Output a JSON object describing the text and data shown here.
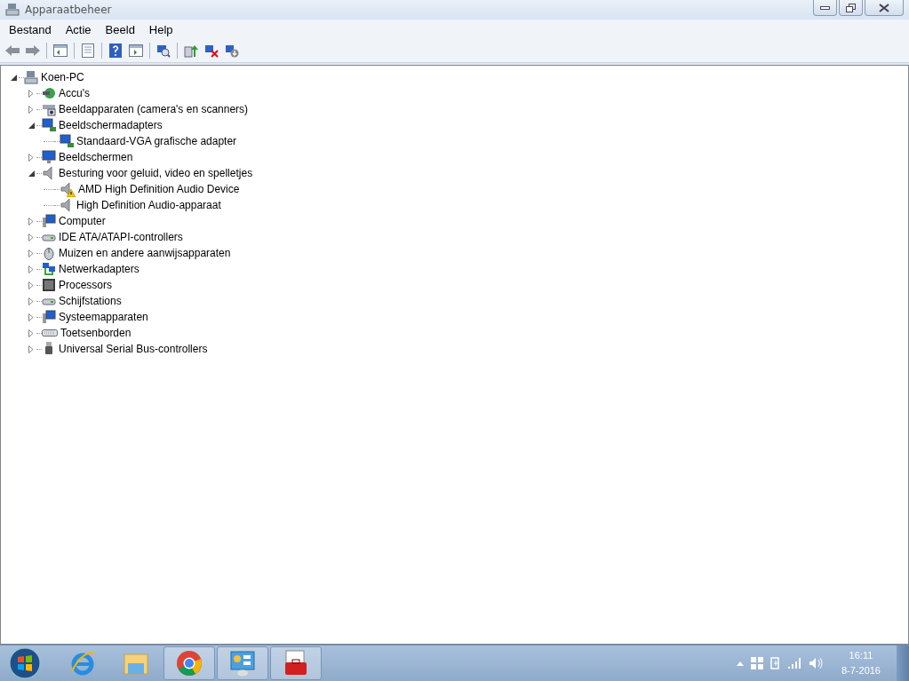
{
  "window": {
    "title": "Apparaatbeheer"
  },
  "menu": [
    "Bestand",
    "Actie",
    "Beeld",
    "Help"
  ],
  "toolbar": [
    {
      "kind": "back",
      "disabled": false
    },
    {
      "kind": "forward",
      "disabled": false
    },
    {
      "kind": "sep"
    },
    {
      "kind": "console"
    },
    {
      "kind": "sep"
    },
    {
      "kind": "properties"
    },
    {
      "kind": "sep"
    },
    {
      "kind": "help"
    },
    {
      "kind": "action"
    },
    {
      "kind": "sep"
    },
    {
      "kind": "scan"
    },
    {
      "kind": "sep"
    },
    {
      "kind": "update"
    },
    {
      "kind": "uninstall"
    },
    {
      "kind": "disable"
    }
  ],
  "tree": {
    "label": "Koen-PC",
    "kind": "pc",
    "expanded": true,
    "children": [
      {
        "label": "Accu's",
        "kind": "battery",
        "expanded": false
      },
      {
        "label": "Beeldapparaten (camera's en scanners)",
        "kind": "scanner",
        "expanded": false
      },
      {
        "label": "Beeldschermadapters",
        "kind": "adapter",
        "expanded": true,
        "children": [
          {
            "label": "Standaard-VGA grafische adapter",
            "kind": "adapter",
            "warning": false
          }
        ]
      },
      {
        "label": "Beeldschermen",
        "kind": "monitor",
        "expanded": false
      },
      {
        "label": "Besturing voor geluid, video en spelletjes",
        "kind": "speaker",
        "expanded": true,
        "children": [
          {
            "label": "AMD High Definition Audio Device",
            "kind": "speaker",
            "warning": true
          },
          {
            "label": "High Definition Audio-apparaat",
            "kind": "speaker",
            "warning": false
          }
        ]
      },
      {
        "label": "Computer",
        "kind": "computer",
        "expanded": false
      },
      {
        "label": "IDE ATA/ATAPI-controllers",
        "kind": "drive",
        "expanded": false
      },
      {
        "label": "Muizen en andere aanwijsapparaten",
        "kind": "mouse",
        "expanded": false
      },
      {
        "label": "Netwerkadapters",
        "kind": "network",
        "expanded": false
      },
      {
        "label": "Processors",
        "kind": "chip",
        "expanded": false
      },
      {
        "label": "Schijfstations",
        "kind": "drive",
        "expanded": false
      },
      {
        "label": "Systeemapparaten",
        "kind": "computer",
        "expanded": false
      },
      {
        "label": "Toetsenborden",
        "kind": "keyboard",
        "expanded": false
      },
      {
        "label": "Universal Serial Bus-controllers",
        "kind": "usb",
        "expanded": false
      }
    ]
  },
  "taskbar": {
    "apps": [
      {
        "kind": "ie",
        "running": false
      },
      {
        "kind": "explorer",
        "running": false
      },
      {
        "kind": "chrome",
        "running": true
      },
      {
        "kind": "control",
        "running": true
      },
      {
        "kind": "toolbox",
        "running": true
      }
    ],
    "tray": {
      "time": "16:11",
      "date": "8-7-2016"
    }
  }
}
